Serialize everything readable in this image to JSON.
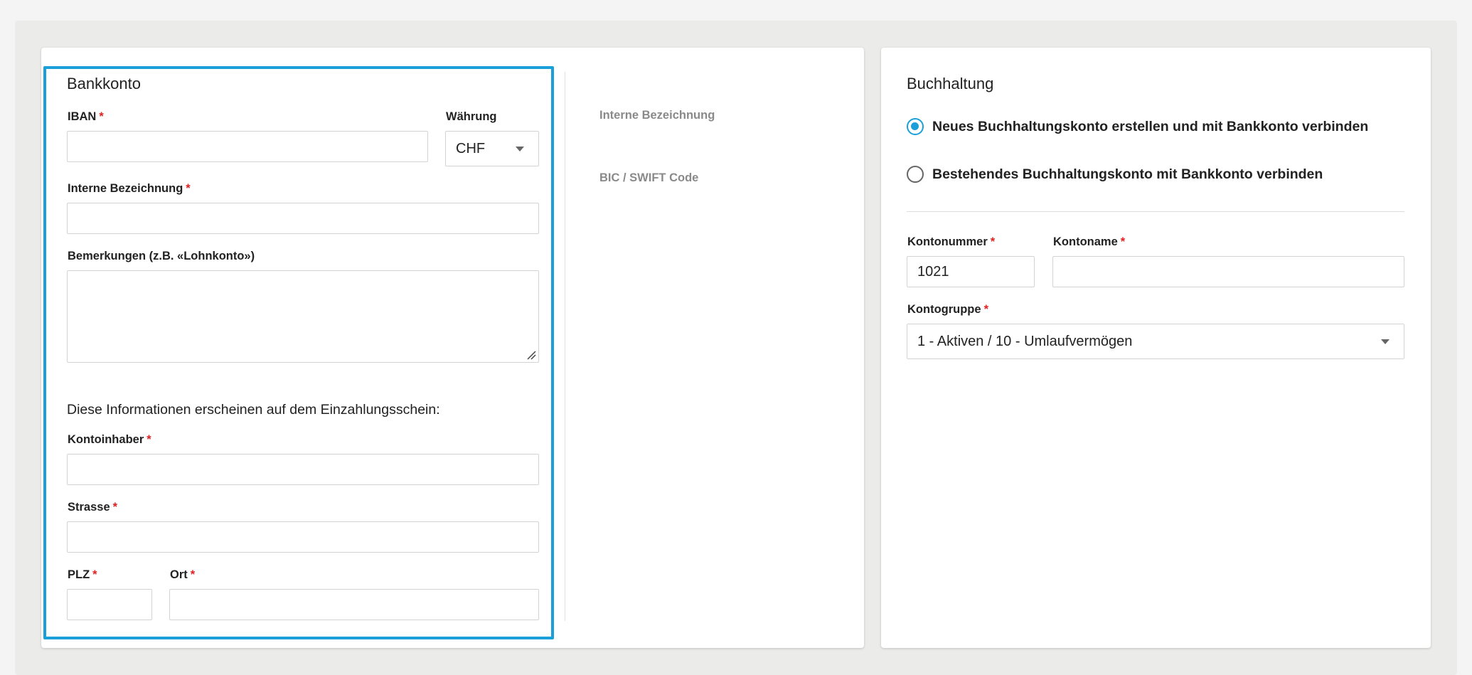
{
  "bank": {
    "title": "Bankkonto",
    "iban": {
      "label": "IBAN",
      "value": ""
    },
    "currency": {
      "label": "Währung",
      "value": "CHF"
    },
    "internal_name": {
      "label": "Interne Bezeichnung",
      "value": ""
    },
    "remarks": {
      "label": "Bemerkungen (z.B. «Lohnkonto»)",
      "value": ""
    },
    "slip_info": "Diese Informationen erscheinen auf dem Einzahlungsschein:",
    "holder": {
      "label": "Kontoinhaber",
      "value": ""
    },
    "street": {
      "label": "Strasse",
      "value": ""
    },
    "zip": {
      "label": "PLZ",
      "value": ""
    },
    "city": {
      "label": "Ort",
      "value": ""
    },
    "required_mark": "*"
  },
  "preview": {
    "internal_name": "Interne Bezeichnung",
    "bic": "BIC / SWIFT Code"
  },
  "accounting": {
    "title": "Buchhaltung",
    "option_new": "Neues Buchhaltungskonto erstellen und mit Bankkonto verbinden",
    "option_existing": "Bestehendes Buchhaltungskonto mit Bankkonto verbinden",
    "selected_option": "new",
    "account_number": {
      "label": "Kontonummer",
      "value": "1021"
    },
    "account_name": {
      "label": "Kontoname",
      "value": ""
    },
    "account_group": {
      "label": "Kontogruppe",
      "value": "1 - Aktiven / 10 - Umlaufvermögen"
    }
  },
  "colors": {
    "accent": "#1a9fd8",
    "required": "#e02020"
  }
}
